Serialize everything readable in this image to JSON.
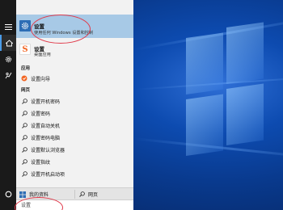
{
  "best_match": {
    "title": "设置",
    "subtitle": "使用任何 Windows 设置和控制",
    "icon": "gear-icon"
  },
  "app_result": {
    "title": "设置",
    "subtitle": "桌面应用",
    "icon": "sogou-s-icon",
    "accent": "#f26522"
  },
  "sections": {
    "apps": "应用",
    "web": "网页"
  },
  "app_items": [
    {
      "label": "设置向导",
      "icon": "wizard-icon"
    }
  ],
  "web_items": [
    {
      "label": "设置开机密码"
    },
    {
      "label": "设置密码"
    },
    {
      "label": "设置自动关机"
    },
    {
      "label": "设置密码电脑"
    },
    {
      "label": "设置默认浏览器"
    },
    {
      "label": "设置指纹"
    },
    {
      "label": "设置开机启动项"
    }
  ],
  "bottom": {
    "my_stuff": "我的资料",
    "web": "网页"
  },
  "search": {
    "value": "设置"
  },
  "colors": {
    "highlight": "#a7c9e6",
    "rail": "#1a1a1a",
    "panel": "#f2f2f2",
    "annotation": "#e03a4a",
    "gear_tile": "#2d6db5"
  }
}
